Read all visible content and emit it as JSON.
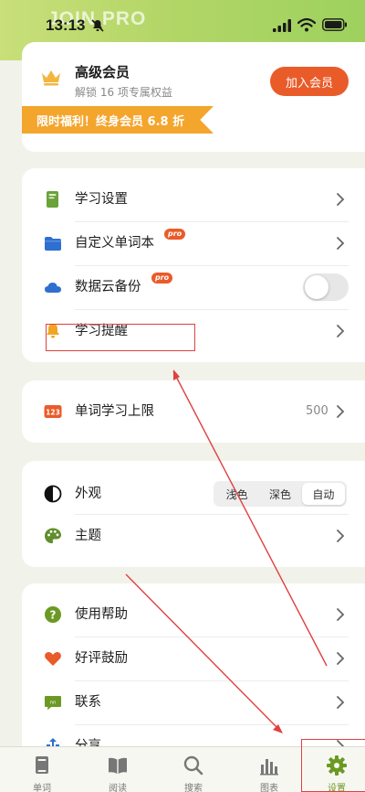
{
  "status_bar": {
    "time": "13:13",
    "overlay_logo": "JOIN PRO"
  },
  "member": {
    "title": "高级会员",
    "subtitle": "解锁 16 项专属权益",
    "join_label": "加入会员",
    "promo": "限时福利！终身会员 6.8 折"
  },
  "study_group": {
    "items": [
      {
        "label": "学习设置",
        "icon": "book-icon",
        "badge": ""
      },
      {
        "label": "自定义单词本",
        "icon": "folder-icon",
        "badge": "pro"
      },
      {
        "label": "数据云备份",
        "icon": "cloud-icon",
        "badge": "pro",
        "toggle_on": false
      },
      {
        "label": "学习提醒",
        "icon": "bell-icon",
        "badge": ""
      }
    ]
  },
  "limit_group": {
    "label": "单词学习上限",
    "icon": "number-123-icon",
    "value": "500"
  },
  "appearance_group": {
    "appearance_label": "外观",
    "options": [
      "浅色",
      "深色",
      "自动"
    ],
    "selected": "自动",
    "theme_label": "主题"
  },
  "help_group": {
    "items": [
      {
        "label": "使用帮助",
        "icon": "help-icon"
      },
      {
        "label": "好评鼓励",
        "icon": "heart-icon"
      },
      {
        "label": "联系",
        "icon": "chat-icon"
      },
      {
        "label": "分享",
        "icon": "share-icon"
      }
    ]
  },
  "tabbar": {
    "tabs": [
      {
        "label": "单词",
        "icon": "book-icon"
      },
      {
        "label": "阅读",
        "icon": "open-book-icon"
      },
      {
        "label": "搜索",
        "icon": "search-icon"
      },
      {
        "label": "图表",
        "icon": "bar-chart-icon"
      },
      {
        "label": "设置",
        "icon": "gear-icon"
      }
    ],
    "active": "设置"
  },
  "colors": {
    "accent_orange": "#ea5b2a",
    "promo_orange": "#f4a52c",
    "active_green": "#6a9a23",
    "header_green": "#b3d667",
    "annotation_red": "#e04040"
  }
}
